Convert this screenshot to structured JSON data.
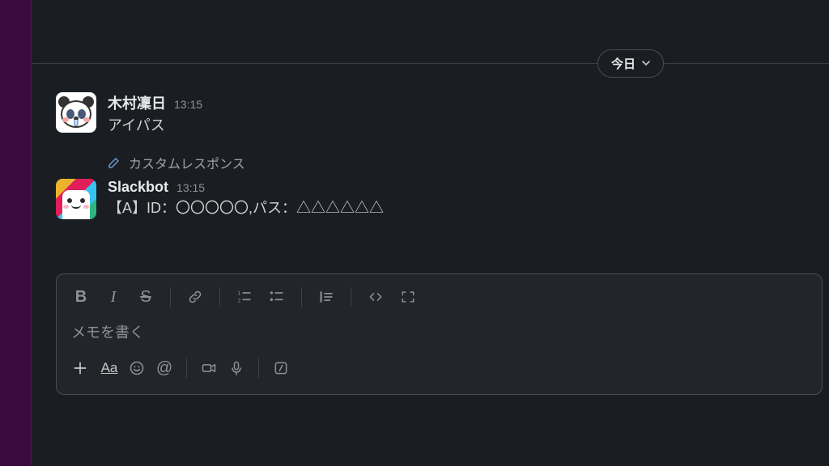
{
  "divider": {
    "label": "今日"
  },
  "messages": [
    {
      "author": "木村凜日",
      "time": "13:15",
      "text": "アイパス"
    },
    {
      "author": "Slackbot",
      "time": "13:15",
      "text": "【A】ID：〇〇〇〇〇,パス：△△△△△△"
    }
  ],
  "custom_response_label": "カスタムレスポンス",
  "composer": {
    "placeholder": "メモを書く"
  }
}
